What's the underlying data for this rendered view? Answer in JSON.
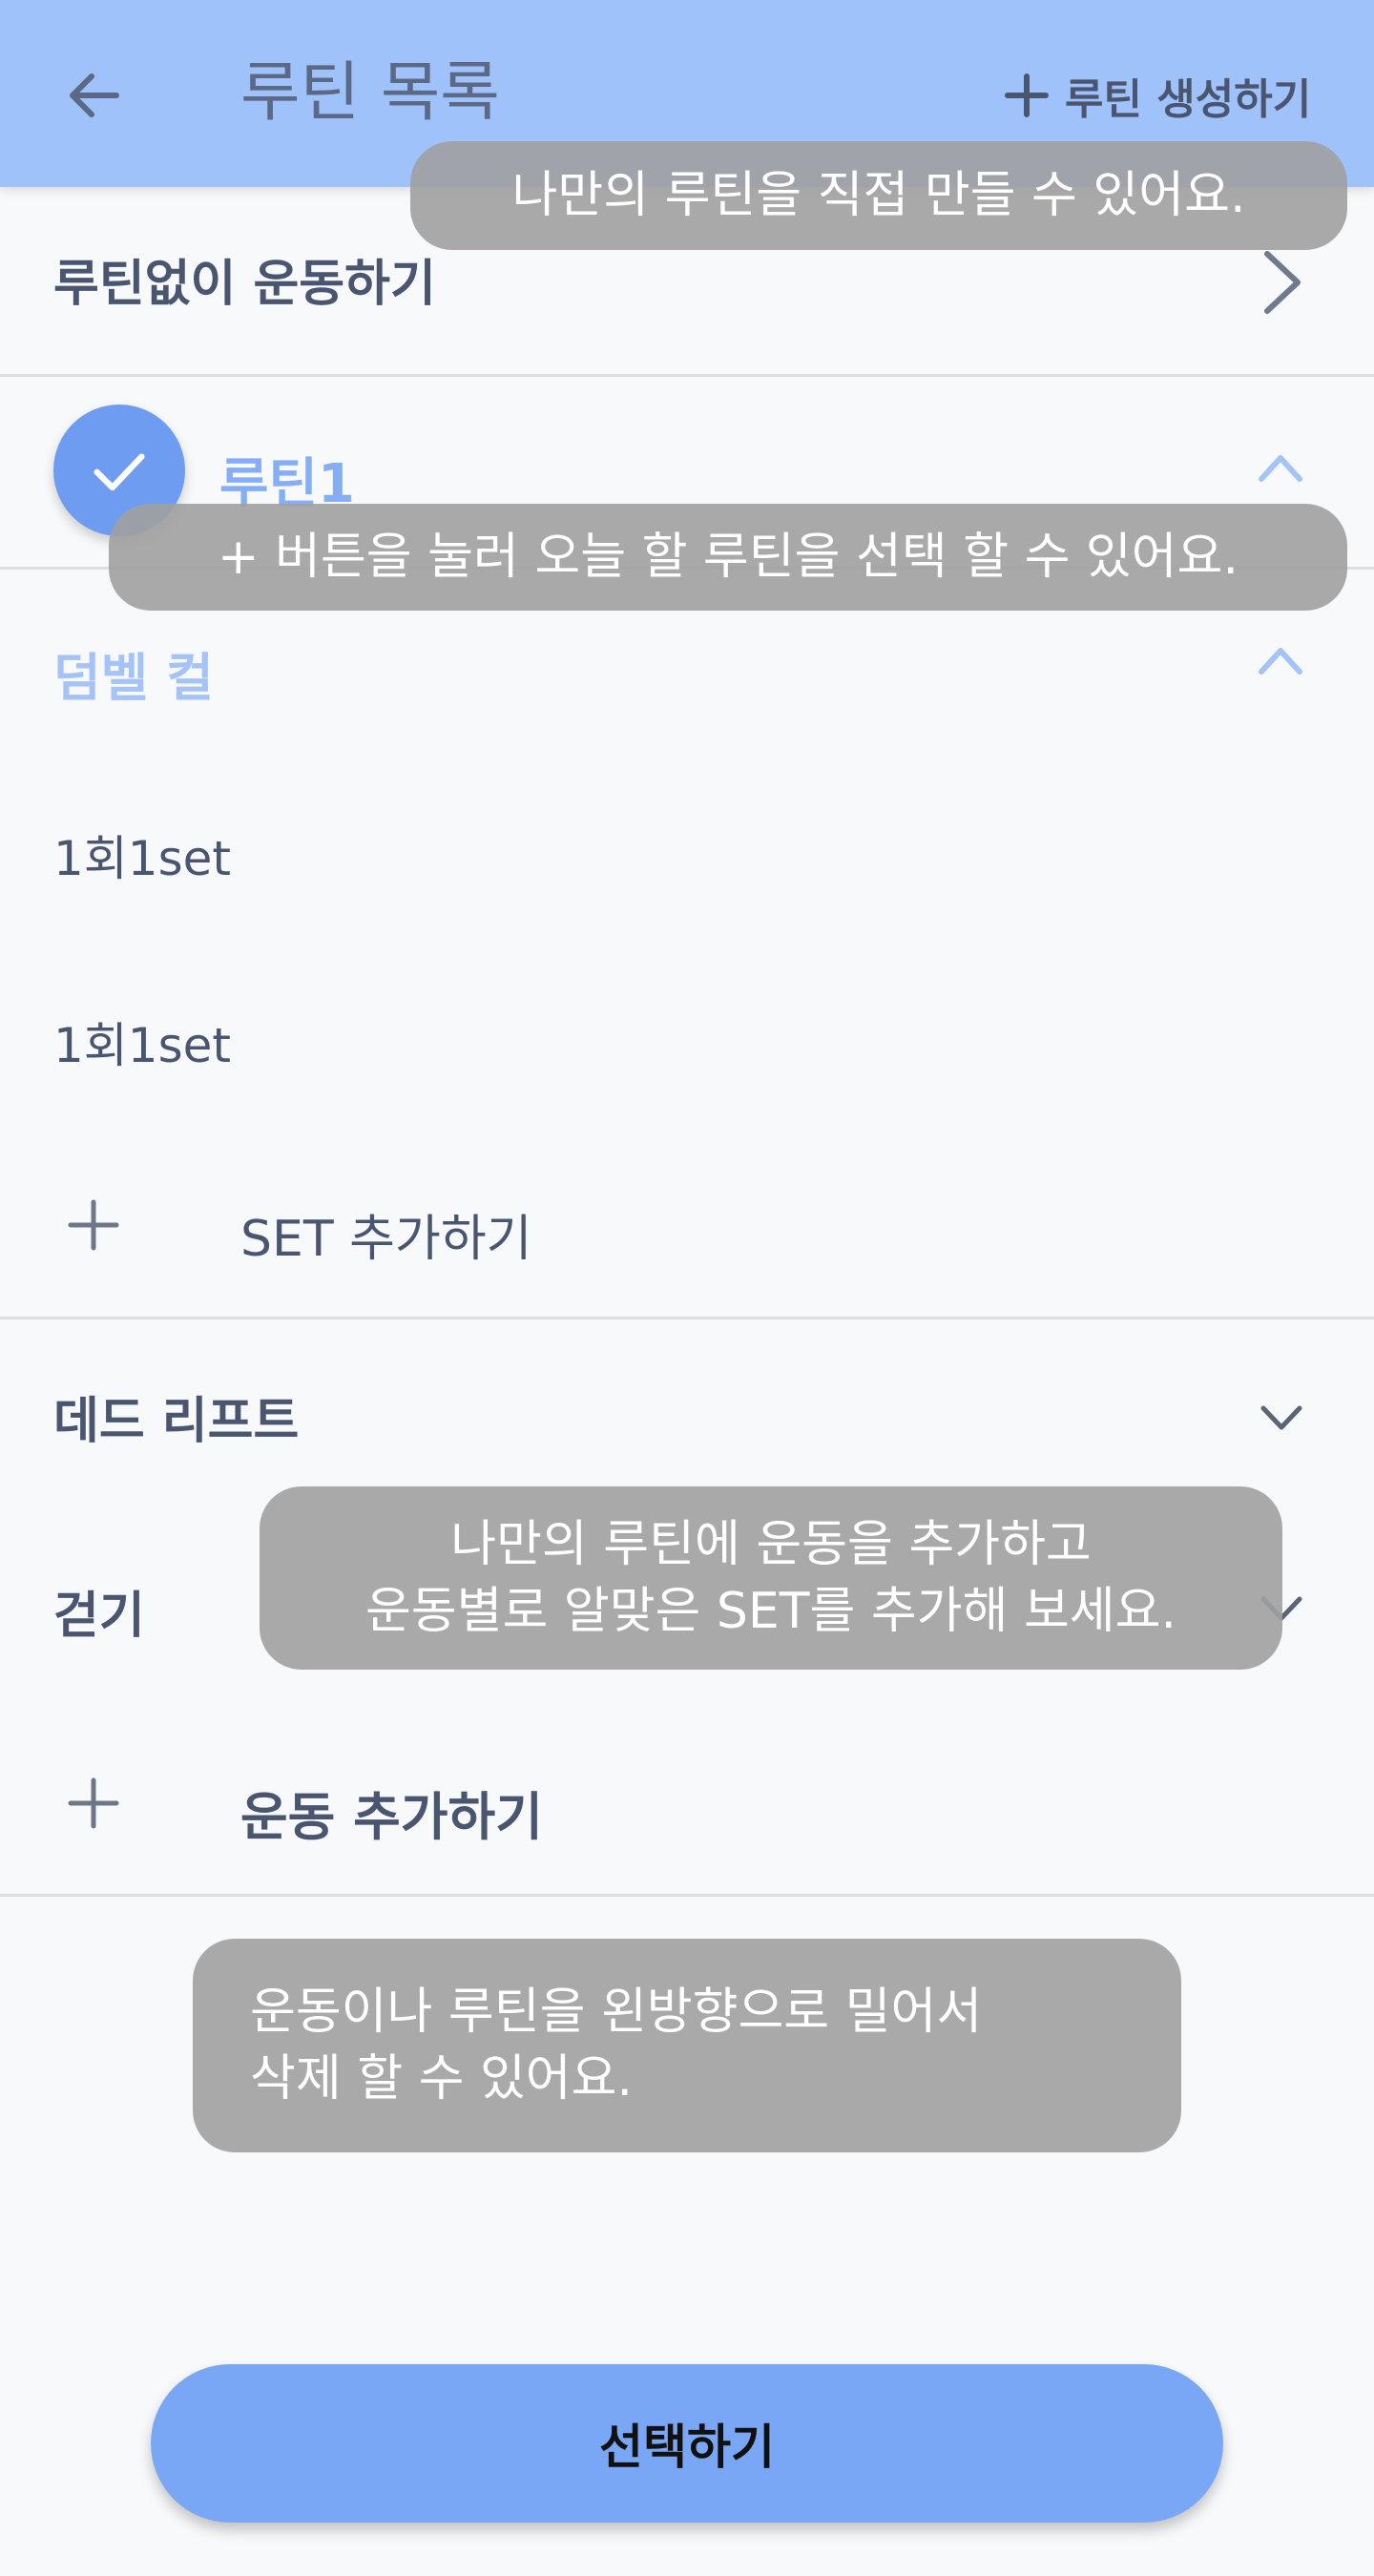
{
  "header": {
    "title": "루틴 목록",
    "create_label": "루틴 생성하기"
  },
  "rows": {
    "no_routine": "루틴없이 운동하기",
    "routine1": "루틴1",
    "exercise1": "덤벨 컬",
    "sets": [
      "1회1set",
      "1회1set"
    ],
    "add_set": "SET 추가하기",
    "exercise2": "데드 리프트",
    "exercise3": "걷기",
    "add_exercise": "운동 추가하기"
  },
  "tooltips": {
    "create": "나만의 루틴을 직접 만들 수 있어요.",
    "select": "+ 버튼을 눌러 오늘 할 루틴을 선택 할 수 있어요.",
    "add": "나만의 루틴에 운동을 추가하고\n운동별로 알맞은 SET를 추가해 보세요.",
    "delete": "운동이나 루틴을 왼방향으로 밀어서\n삭제 할 수 있어요."
  },
  "footer": {
    "select_label": "선택하기"
  },
  "colors": {
    "header_bg": "#a0c2fb",
    "accent": "#7aa7f5",
    "selected_text": "#86aef5"
  },
  "icons": [
    "back-arrow-icon",
    "plus-icon",
    "chevron-right-icon",
    "check-icon",
    "chevron-up-icon",
    "chevron-down-icon"
  ]
}
